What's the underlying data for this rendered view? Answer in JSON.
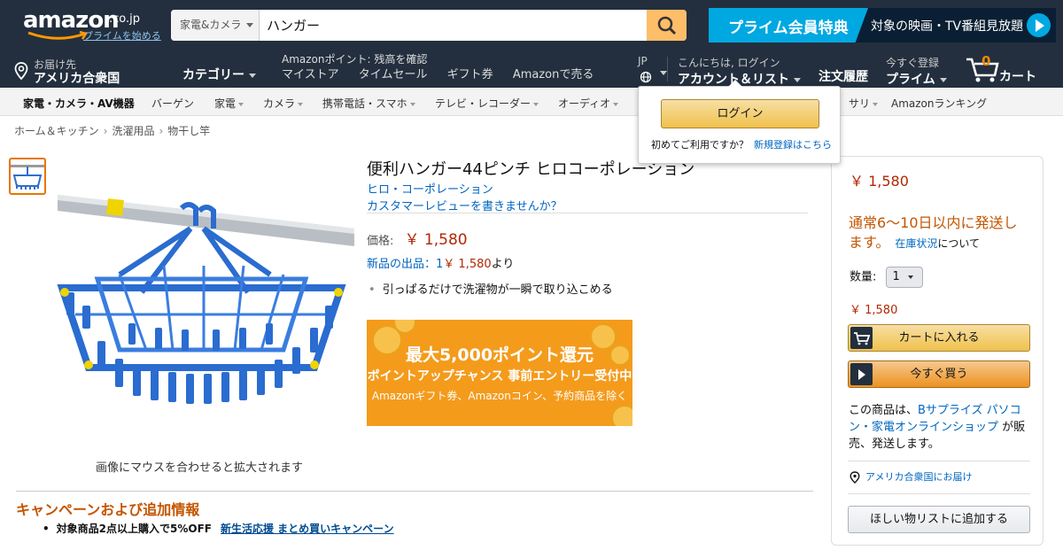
{
  "header": {
    "logo_text": "amazon",
    "logo_domain": ".co.jp",
    "prime_start": "プライムを始める",
    "search": {
      "category": "家電&カメラ",
      "query": "ハンガー"
    },
    "prime_banner": {
      "left": "プライム会員特典",
      "right": "対象の映画・TV番組見放題"
    },
    "deliver_to": {
      "line1": "お届け先",
      "line2": "アメリカ合衆国"
    },
    "categories": "カテゴリー",
    "points": "Amazonポイント: 残高を確認",
    "links": [
      "マイストア",
      "タイムセール",
      "ギフト券",
      "Amazonで売る"
    ],
    "lang": "JP",
    "account": {
      "line1": "こんにちは, ログイン",
      "line2": "アカウント＆リスト"
    },
    "orders": "注文履歴",
    "prime": {
      "line1": "今すぐ登録",
      "line2": "プライム"
    },
    "cart": {
      "count": "0",
      "label": "カート"
    }
  },
  "subnav": {
    "items": [
      "家電・カメラ・AV機器",
      "バーゲン",
      "家電",
      "カメラ",
      "携帯電話・スマホ",
      "テレビ・レコーダー",
      "オーディオ",
      "サリ",
      "Amazonランキング"
    ]
  },
  "breadcrumb": [
    "ホーム＆キッチン",
    "洗濯用品",
    "物干し竿"
  ],
  "product": {
    "title": "便利ハンガー44ピンチ ヒロコーポレーション",
    "brand": "ヒロ・コーポレーション",
    "review_link": "カスタマーレビューを書きませんか？",
    "price_label": "価格:",
    "price": "￥ 1,580",
    "new_offers": {
      "prefix": "新品の出品：1",
      "price": "￥ 1,580",
      "suffix": "より"
    },
    "bullet": "引っぱるだけで洗濯物が一瞬で取り込こめる",
    "hover_hint": "画像にマウスを合わせると拡大されます",
    "promo": {
      "line1": "最大5,000ポイント還元",
      "line2": "ポイントアップチャンス 事前エントリー受付中",
      "line3": "Amazonギフト券、Amazonコイン、予約商品を除く"
    }
  },
  "campaign": {
    "title": "キャンペーンおよび追加情報",
    "item": "対象商品2点以上購入で5%OFF",
    "link": "新生活応援 まとめ買いキャンペーン"
  },
  "buybox": {
    "price": "￥ 1,580",
    "shipping": "通常6～10日以内に発送します。",
    "stock_link": "在庫状況",
    "stock_suffix": "について",
    "qty_label": "数量:",
    "qty_value": "1",
    "price2": "￥ 1,580",
    "add_to_cart": "カートに入れる",
    "buy_now": "今すぐ買う",
    "seller_prefix": "この商品は、",
    "seller_link": "Bサプライズ パソコン・家電オンラインショップ",
    "seller_suffix": " が販売、発送します。",
    "ship_to": "アメリカ合衆国にお届け",
    "wishlist": "ほしい物リストに追加する"
  },
  "flyout": {
    "login": "ログイン",
    "first_time": "初めてご利用ですか？",
    "register": "新規登録はこちら"
  },
  "colors": {
    "nav_bg": "#232f3e",
    "price": "#b12704",
    "link": "#0066c0",
    "accent_orange": "#c45500",
    "prime_blue": "#00a8e1"
  }
}
